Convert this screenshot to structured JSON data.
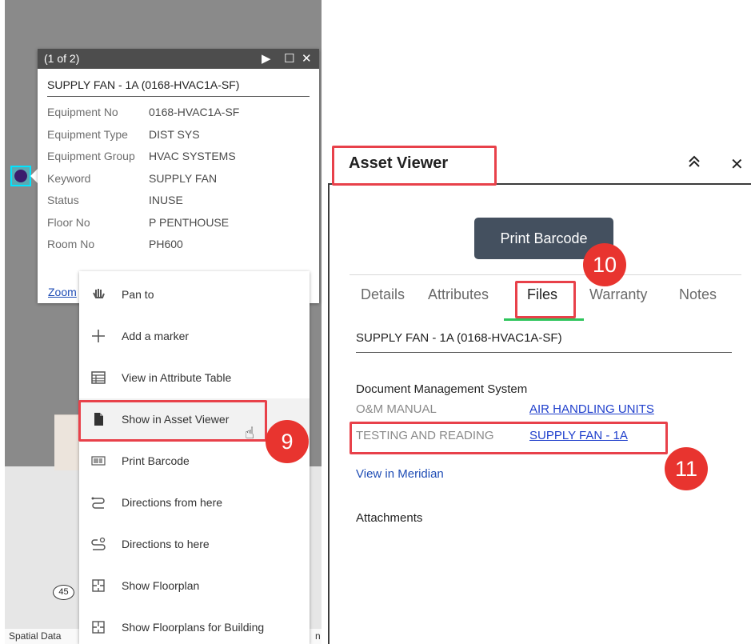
{
  "map": {
    "route_shield": "45",
    "attribution": "Spatial Data",
    "attribution_tail": "n S"
  },
  "popup": {
    "counter": "(1 of 2)",
    "title": "SUPPLY FAN - 1A (0168-HVAC1A-SF)",
    "fields": [
      {
        "key": "Equipment No",
        "value": "0168-HVAC1A-SF"
      },
      {
        "key": "Equipment Type",
        "value": "DIST SYS"
      },
      {
        "key": "Equipment Group",
        "value": "HVAC SYSTEMS"
      },
      {
        "key": "Keyword",
        "value": "SUPPLY FAN"
      },
      {
        "key": "Status",
        "value": "INUSE"
      },
      {
        "key": "Floor No",
        "value": "P PENTHOUSE"
      },
      {
        "key": "Room No",
        "value": "PH600"
      }
    ],
    "zoom_link": "Zoom"
  },
  "context_menu": {
    "items": [
      {
        "label": "Pan to",
        "icon": "pan-icon"
      },
      {
        "label": "Add a marker",
        "icon": "plus-icon"
      },
      {
        "label": "View in Attribute Table",
        "icon": "table-icon"
      },
      {
        "label": "Show in Asset Viewer",
        "icon": "document-icon"
      },
      {
        "label": "Print Barcode",
        "icon": "barcode-icon"
      },
      {
        "label": "Directions from here",
        "icon": "route-icon"
      },
      {
        "label": "Directions to here",
        "icon": "route-pin-icon"
      },
      {
        "label": "Show Floorplan",
        "icon": "floorplan-icon"
      },
      {
        "label": "Show Floorplans for Building",
        "icon": "floorplan-icon"
      }
    ]
  },
  "asset_viewer": {
    "title": "Asset Viewer",
    "print_button": "Print Barcode",
    "tabs": [
      "Details",
      "Attributes",
      "Files",
      "Warranty",
      "Notes"
    ],
    "active_tab": "Files",
    "files": {
      "asset_title": "SUPPLY FAN - 1A (0168-HVAC1A-SF)",
      "dms_title": "Document Management System",
      "documents": [
        {
          "key": "O&M MANUAL",
          "value": "AIR HANDLING UNITS"
        },
        {
          "key": "TESTING AND READING",
          "value": "SUPPLY FAN - 1A"
        }
      ],
      "view_link": "View in Meridian",
      "attachments_title": "Attachments"
    }
  },
  "callouts": {
    "step9": "9",
    "step10": "10",
    "step11": "11"
  },
  "colors": {
    "highlight": "#e8414a",
    "badge": "#e8342f",
    "tab_underline": "#2ec55c",
    "button": "#44505f"
  }
}
